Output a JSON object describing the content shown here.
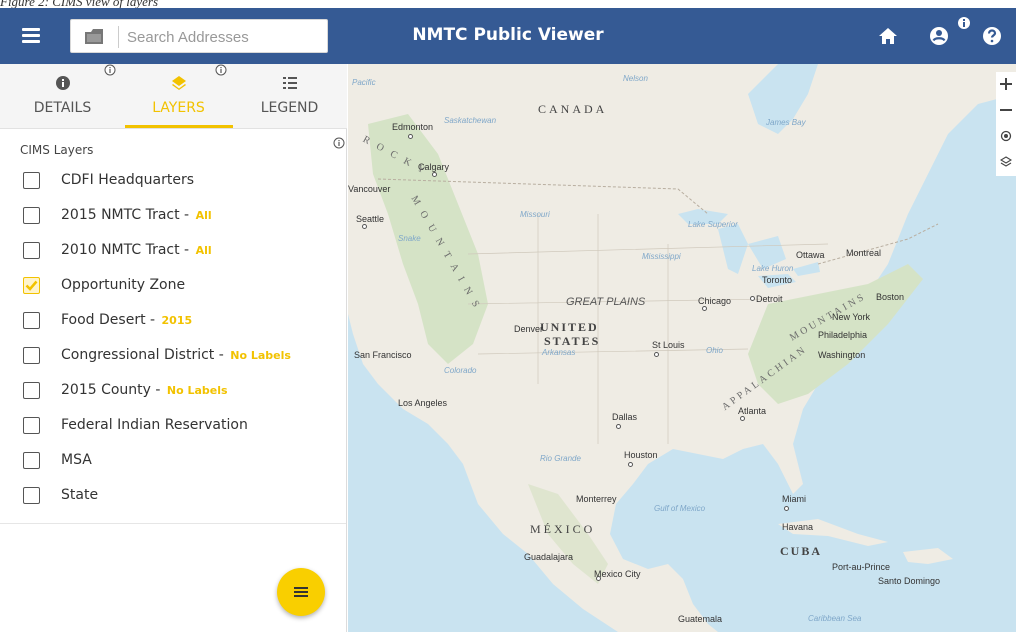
{
  "caption": "Figure 2: CIMS view of layers",
  "header": {
    "title": "NMTC Public Viewer",
    "search_placeholder": "Search Addresses",
    "icons": [
      "menu-icon",
      "folder-icon",
      "home-icon",
      "account-icon",
      "info-icon",
      "help-icon"
    ]
  },
  "tabs": [
    {
      "label": "DETAILS",
      "icon": "info-icon",
      "active": false
    },
    {
      "label": "LAYERS",
      "icon": "layers-icon",
      "active": true
    },
    {
      "label": "LEGEND",
      "icon": "legend-list-icon",
      "active": false
    }
  ],
  "layers_panel": {
    "title": "CIMS Layers",
    "items": [
      {
        "label": "CDFI Headquarters",
        "option": "",
        "checked": false
      },
      {
        "label": "2015 NMTC Tract -",
        "option": "All",
        "checked": false
      },
      {
        "label": "2010 NMTC Tract -",
        "option": "All",
        "checked": false
      },
      {
        "label": "Opportunity Zone",
        "option": "",
        "checked": true
      },
      {
        "label": "Food Desert -",
        "option": "2015",
        "checked": false
      },
      {
        "label": "Congressional District -",
        "option": "No Labels",
        "checked": false
      },
      {
        "label": "2015 County -",
        "option": "No Labels",
        "checked": false
      },
      {
        "label": "Federal Indian Reservation",
        "option": "",
        "checked": false
      },
      {
        "label": "MSA",
        "option": "",
        "checked": false
      },
      {
        "label": "State",
        "option": "",
        "checked": false
      }
    ]
  },
  "map": {
    "labels": {
      "pacific": "Pacific",
      "canada": "CANADA",
      "nelson": "Nelson",
      "edmonton": "Edmonton",
      "saskatchewan": "Saskatchewan",
      "james_bay": "James Bay",
      "calgary": "Calgary",
      "vancouver": "Vancouver",
      "seattle": "Seattle",
      "missouri": "Missouri",
      "lake_superior": "Lake Superior",
      "snake": "Snake",
      "ottawa": "Ottawa",
      "montreal": "Montreal",
      "lake_huron": "Lake Huron",
      "toronto": "Toronto",
      "mississippi": "Mississippi",
      "boston": "Boston",
      "great_plains": "GREAT PLAINS",
      "chicago": "Chicago",
      "detroit": "Detroit",
      "new_york": "New York",
      "united": "UNITED",
      "states": "STATES",
      "denver": "Denver",
      "philadelphia": "Philadelphia",
      "arkansas": "Arkansas",
      "st_louis": "St Louis",
      "ohio": "Ohio",
      "washington": "Washington",
      "san_francisco": "San Francisco",
      "colorado": "Colorado",
      "los_angeles": "Los Angeles",
      "atlanta": "Atlanta",
      "dallas": "Dallas",
      "houston": "Houston",
      "rio_grande": "Rio Grande",
      "monterrey": "Monterrey",
      "gulf_of_mexico": "Gulf of Mexico",
      "miami": "Miami",
      "mexico": "MÉXICO",
      "havana": "Havana",
      "cuba": "CUBA",
      "guadalajara": "Guadalajara",
      "mexico_city": "Mexico City",
      "port_au_prince": "Port-au-Prince",
      "santo_domingo": "Santo Domingo",
      "guatemala": "Guatemala",
      "caribbean_sea": "Caribbean Sea",
      "rocky": "R O C K Y",
      "mountains": "M O U N T A I N S",
      "appalachian": "APPALACHIAN",
      "appalachian_mtns": "MOUNTAINS"
    },
    "controls": [
      "zoom-in",
      "zoom-out",
      "locate",
      "basemap-layers"
    ],
    "colors": {
      "land": "#efece4",
      "water": "#c9e3f0",
      "forest": "#d5e3c6"
    }
  },
  "colors": {
    "header": "#355a94",
    "accent": "#f2c200",
    "fab": "#f9cf00"
  }
}
